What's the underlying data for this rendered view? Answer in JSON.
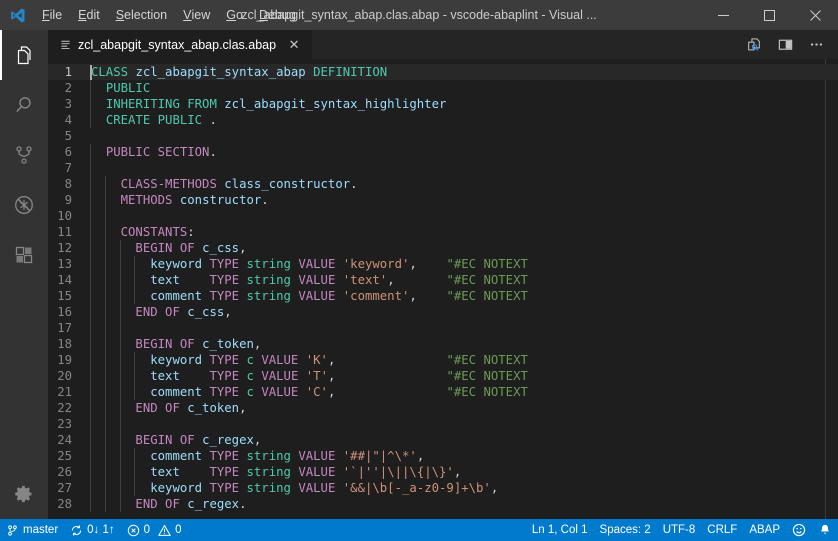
{
  "window": {
    "title": "zcl_abapgit_syntax_abap.clas.abap - vscode-abaplint - Visual ...",
    "logo_icon": "vscode-logo-icon",
    "minimize_icon": "minimize-icon",
    "maximize_icon": "maximize-icon",
    "close_icon": "close-icon"
  },
  "menubar": {
    "items": [
      {
        "label": "File",
        "mnemonic": "F",
        "rest": "ile"
      },
      {
        "label": "Edit",
        "mnemonic": "E",
        "rest": "dit"
      },
      {
        "label": "Selection",
        "mnemonic": "S",
        "rest": "election"
      },
      {
        "label": "View",
        "mnemonic": "V",
        "rest": "iew"
      },
      {
        "label": "Go",
        "mnemonic": "G",
        "rest": "o"
      },
      {
        "label": "Debug",
        "mnemonic": "D",
        "rest": "ebug"
      }
    ]
  },
  "activitybar": {
    "items": [
      {
        "name": "explorer",
        "icon": "files-icon",
        "active": true
      },
      {
        "name": "search",
        "icon": "search-icon",
        "active": false
      },
      {
        "name": "source-control",
        "icon": "source-control-branch-icon",
        "active": false
      },
      {
        "name": "run-and-debug",
        "icon": "debug-no-bug-icon",
        "active": false
      },
      {
        "name": "extensions",
        "icon": "extensions-blocks-icon",
        "active": false
      }
    ],
    "bottom": [
      {
        "name": "manage",
        "icon": "gear-icon"
      }
    ]
  },
  "tabs": {
    "items": [
      {
        "label": "zcl_abapgit_syntax_abap.clas.abap",
        "icon": "file-lines-icon",
        "close_glyph": "✕",
        "active": true
      }
    ],
    "actions": [
      {
        "name": "open-preview",
        "icon": "preview-search-icon"
      },
      {
        "name": "split-editor",
        "icon": "split-editor-icon"
      },
      {
        "name": "more-actions",
        "icon": "ellipsis-icon",
        "glyph": "⋯"
      }
    ]
  },
  "editor": {
    "language": "ABAP",
    "cursor_line": 1,
    "first_line": 1,
    "lines": [
      {
        "n": 1,
        "indent": 0,
        "tokens": [
          {
            "t": "CLASS",
            "c": "kw"
          },
          {
            "t": " ",
            "c": "punct"
          },
          {
            "t": "zcl_abapgit_syntax_abap",
            "c": "ident"
          },
          {
            "t": " ",
            "c": "punct"
          },
          {
            "t": "DEFINITION",
            "c": "kw"
          }
        ]
      },
      {
        "n": 2,
        "indent": 2,
        "tokens": [
          {
            "t": "PUBLIC",
            "c": "kw"
          }
        ]
      },
      {
        "n": 3,
        "indent": 2,
        "tokens": [
          {
            "t": "INHERITING FROM",
            "c": "kw"
          },
          {
            "t": " ",
            "c": "punct"
          },
          {
            "t": "zcl_abapgit_syntax_highlighter",
            "c": "ident"
          }
        ]
      },
      {
        "n": 4,
        "indent": 2,
        "tokens": [
          {
            "t": "CREATE PUBLIC",
            "c": "kw"
          },
          {
            "t": " ",
            "c": "punct"
          },
          {
            "t": ".",
            "c": "punct"
          }
        ]
      },
      {
        "n": 5,
        "indent": 0,
        "tokens": []
      },
      {
        "n": 6,
        "indent": 2,
        "tokens": [
          {
            "t": "PUBLIC SECTION",
            "c": "kw2"
          },
          {
            "t": ".",
            "c": "punct"
          }
        ]
      },
      {
        "n": 7,
        "indent": 2,
        "tokens": []
      },
      {
        "n": 8,
        "indent": 4,
        "tokens": [
          {
            "t": "CLASS-METHODS",
            "c": "kw2"
          },
          {
            "t": " ",
            "c": "punct"
          },
          {
            "t": "class_constructor",
            "c": "ident"
          },
          {
            "t": ".",
            "c": "punct"
          }
        ]
      },
      {
        "n": 9,
        "indent": 4,
        "tokens": [
          {
            "t": "METHODS",
            "c": "kw2"
          },
          {
            "t": " ",
            "c": "punct"
          },
          {
            "t": "constructor",
            "c": "ident"
          },
          {
            "t": ".",
            "c": "punct"
          }
        ]
      },
      {
        "n": 10,
        "indent": 4,
        "tokens": []
      },
      {
        "n": 11,
        "indent": 4,
        "tokens": [
          {
            "t": "CONSTANTS",
            "c": "kw2"
          },
          {
            "t": ":",
            "c": "punct"
          }
        ]
      },
      {
        "n": 12,
        "indent": 6,
        "tokens": [
          {
            "t": "BEGIN OF",
            "c": "kw2"
          },
          {
            "t": " ",
            "c": "punct"
          },
          {
            "t": "c_css",
            "c": "ident"
          },
          {
            "t": ",",
            "c": "punct"
          }
        ]
      },
      {
        "n": 13,
        "indent": 8,
        "tokens": [
          {
            "t": "keyword",
            "c": "ident"
          },
          {
            "t": " ",
            "c": "punct"
          },
          {
            "t": "TYPE",
            "c": "kw2"
          },
          {
            "t": " ",
            "c": "punct"
          },
          {
            "t": "string",
            "c": "kw"
          },
          {
            "t": " ",
            "c": "punct"
          },
          {
            "t": "VALUE",
            "c": "kw2"
          },
          {
            "t": " ",
            "c": "punct"
          },
          {
            "t": "'keyword'",
            "c": "str"
          },
          {
            "t": ",",
            "c": "punct"
          }
        ],
        "trailing_comment": "\"#EC NOTEXT",
        "comment_col": 48
      },
      {
        "n": 14,
        "indent": 8,
        "tokens": [
          {
            "t": "text",
            "c": "ident"
          },
          {
            "t": "    ",
            "c": "punct"
          },
          {
            "t": "TYPE",
            "c": "kw2"
          },
          {
            "t": " ",
            "c": "punct"
          },
          {
            "t": "string",
            "c": "kw"
          },
          {
            "t": " ",
            "c": "punct"
          },
          {
            "t": "VALUE",
            "c": "kw2"
          },
          {
            "t": " ",
            "c": "punct"
          },
          {
            "t": "'text'",
            "c": "str"
          },
          {
            "t": ",",
            "c": "punct"
          }
        ],
        "trailing_comment": "\"#EC NOTEXT",
        "comment_col": 48
      },
      {
        "n": 15,
        "indent": 8,
        "tokens": [
          {
            "t": "comment",
            "c": "ident"
          },
          {
            "t": " ",
            "c": "punct"
          },
          {
            "t": "TYPE",
            "c": "kw2"
          },
          {
            "t": " ",
            "c": "punct"
          },
          {
            "t": "string",
            "c": "kw"
          },
          {
            "t": " ",
            "c": "punct"
          },
          {
            "t": "VALUE",
            "c": "kw2"
          },
          {
            "t": " ",
            "c": "punct"
          },
          {
            "t": "'comment'",
            "c": "str"
          },
          {
            "t": ",",
            "c": "punct"
          }
        ],
        "trailing_comment": "\"#EC NOTEXT",
        "comment_col": 48
      },
      {
        "n": 16,
        "indent": 6,
        "tokens": [
          {
            "t": "END OF",
            "c": "kw2"
          },
          {
            "t": " ",
            "c": "punct"
          },
          {
            "t": "c_css",
            "c": "ident"
          },
          {
            "t": ",",
            "c": "punct"
          }
        ]
      },
      {
        "n": 17,
        "indent": 6,
        "tokens": []
      },
      {
        "n": 18,
        "indent": 6,
        "tokens": [
          {
            "t": "BEGIN OF",
            "c": "kw2"
          },
          {
            "t": " ",
            "c": "punct"
          },
          {
            "t": "c_token",
            "c": "ident"
          },
          {
            "t": ",",
            "c": "punct"
          }
        ]
      },
      {
        "n": 19,
        "indent": 8,
        "tokens": [
          {
            "t": "keyword",
            "c": "ident"
          },
          {
            "t": " ",
            "c": "punct"
          },
          {
            "t": "TYPE",
            "c": "kw2"
          },
          {
            "t": " ",
            "c": "punct"
          },
          {
            "t": "c",
            "c": "kw"
          },
          {
            "t": " ",
            "c": "punct"
          },
          {
            "t": "VALUE",
            "c": "kw2"
          },
          {
            "t": " ",
            "c": "punct"
          },
          {
            "t": "'K'",
            "c": "str"
          },
          {
            "t": ",",
            "c": "punct"
          }
        ],
        "trailing_comment": "\"#EC NOTEXT",
        "comment_col": 48
      },
      {
        "n": 20,
        "indent": 8,
        "tokens": [
          {
            "t": "text",
            "c": "ident"
          },
          {
            "t": "    ",
            "c": "punct"
          },
          {
            "t": "TYPE",
            "c": "kw2"
          },
          {
            "t": " ",
            "c": "punct"
          },
          {
            "t": "c",
            "c": "kw"
          },
          {
            "t": " ",
            "c": "punct"
          },
          {
            "t": "VALUE",
            "c": "kw2"
          },
          {
            "t": " ",
            "c": "punct"
          },
          {
            "t": "'T'",
            "c": "str"
          },
          {
            "t": ",",
            "c": "punct"
          }
        ],
        "trailing_comment": "\"#EC NOTEXT",
        "comment_col": 48
      },
      {
        "n": 21,
        "indent": 8,
        "tokens": [
          {
            "t": "comment",
            "c": "ident"
          },
          {
            "t": " ",
            "c": "punct"
          },
          {
            "t": "TYPE",
            "c": "kw2"
          },
          {
            "t": " ",
            "c": "punct"
          },
          {
            "t": "c",
            "c": "kw"
          },
          {
            "t": " ",
            "c": "punct"
          },
          {
            "t": "VALUE",
            "c": "kw2"
          },
          {
            "t": " ",
            "c": "punct"
          },
          {
            "t": "'C'",
            "c": "str"
          },
          {
            "t": ",",
            "c": "punct"
          }
        ],
        "trailing_comment": "\"#EC NOTEXT",
        "comment_col": 48
      },
      {
        "n": 22,
        "indent": 6,
        "tokens": [
          {
            "t": "END OF",
            "c": "kw2"
          },
          {
            "t": " ",
            "c": "punct"
          },
          {
            "t": "c_token",
            "c": "ident"
          },
          {
            "t": ",",
            "c": "punct"
          }
        ]
      },
      {
        "n": 23,
        "indent": 6,
        "tokens": []
      },
      {
        "n": 24,
        "indent": 6,
        "tokens": [
          {
            "t": "BEGIN OF",
            "c": "kw2"
          },
          {
            "t": " ",
            "c": "punct"
          },
          {
            "t": "c_regex",
            "c": "ident"
          },
          {
            "t": ",",
            "c": "punct"
          }
        ]
      },
      {
        "n": 25,
        "indent": 8,
        "tokens": [
          {
            "t": "comment",
            "c": "ident"
          },
          {
            "t": " ",
            "c": "punct"
          },
          {
            "t": "TYPE",
            "c": "kw2"
          },
          {
            "t": " ",
            "c": "punct"
          },
          {
            "t": "string",
            "c": "kw"
          },
          {
            "t": " ",
            "c": "punct"
          },
          {
            "t": "VALUE",
            "c": "kw2"
          },
          {
            "t": " ",
            "c": "punct"
          },
          {
            "t": "'##|\"|^\\*'",
            "c": "str"
          },
          {
            "t": ",",
            "c": "punct"
          }
        ]
      },
      {
        "n": 26,
        "indent": 8,
        "tokens": [
          {
            "t": "text",
            "c": "ident"
          },
          {
            "t": "    ",
            "c": "punct"
          },
          {
            "t": "TYPE",
            "c": "kw2"
          },
          {
            "t": " ",
            "c": "punct"
          },
          {
            "t": "string",
            "c": "kw"
          },
          {
            "t": " ",
            "c": "punct"
          },
          {
            "t": "VALUE",
            "c": "kw2"
          },
          {
            "t": " ",
            "c": "punct"
          },
          {
            "t": "'`|''|\\||\\{|\\}'",
            "c": "str"
          },
          {
            "t": ",",
            "c": "punct"
          }
        ]
      },
      {
        "n": 27,
        "indent": 8,
        "tokens": [
          {
            "t": "keyword",
            "c": "ident"
          },
          {
            "t": " ",
            "c": "punct"
          },
          {
            "t": "TYPE",
            "c": "kw2"
          },
          {
            "t": " ",
            "c": "punct"
          },
          {
            "t": "string",
            "c": "kw"
          },
          {
            "t": " ",
            "c": "punct"
          },
          {
            "t": "VALUE",
            "c": "kw2"
          },
          {
            "t": " ",
            "c": "punct"
          },
          {
            "t": "'&&|\\b[-_a-z0-9]+\\b'",
            "c": "str"
          },
          {
            "t": ",",
            "c": "punct"
          }
        ]
      },
      {
        "n": 28,
        "indent": 6,
        "tokens": [
          {
            "t": "END OF",
            "c": "kw2"
          },
          {
            "t": " ",
            "c": "punct"
          },
          {
            "t": "c_regex",
            "c": "ident"
          },
          {
            "t": ".",
            "c": "punct"
          }
        ]
      }
    ]
  },
  "statusbar": {
    "left": [
      {
        "name": "branch",
        "icon": "source-control-branch-icon",
        "label": "master"
      },
      {
        "name": "sync",
        "icon": "sync-icon",
        "label": "0↓ 1↑"
      },
      {
        "name": "errors",
        "icon": "error-circle-icon",
        "label": "0"
      },
      {
        "name": "warnings",
        "icon": "warning-triangle-icon",
        "label": "0"
      }
    ],
    "right": [
      {
        "name": "cursor-position",
        "label": "Ln 1, Col 1"
      },
      {
        "name": "indentation",
        "label": "Spaces: 2"
      },
      {
        "name": "encoding",
        "label": "UTF-8"
      },
      {
        "name": "eol",
        "label": "CRLF"
      },
      {
        "name": "language-mode",
        "label": "ABAP"
      },
      {
        "name": "feedback",
        "icon": "smiley-icon",
        "label": ""
      },
      {
        "name": "notifications",
        "icon": "bell-icon",
        "label": ""
      }
    ]
  },
  "colors": {
    "titlebar_bg": "#3c3c3c",
    "activitybar_bg": "#333333",
    "tabsbar_bg": "#252526",
    "editor_bg": "#1e1e1e",
    "statusbar_bg": "#007acc",
    "accent_blue": "#007acc",
    "keyword_teal": "#4ec9b0",
    "keyword_purple": "#c586c0",
    "identifier_blue": "#9cdcfe",
    "string_orange": "#ce9178",
    "comment_green": "#6a9955"
  }
}
